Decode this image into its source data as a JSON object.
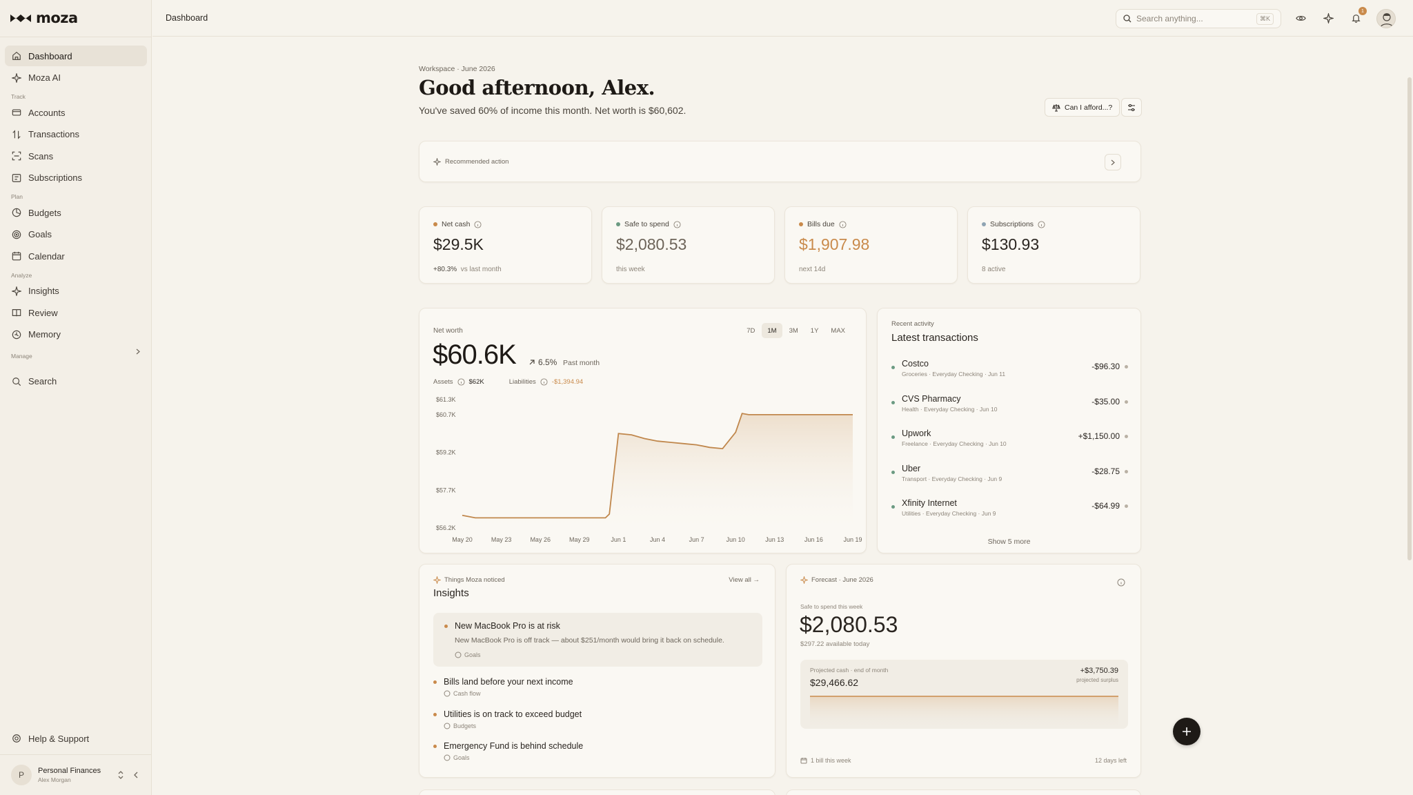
{
  "app": {
    "name": "moza"
  },
  "sidebar": {
    "nav_top": [
      {
        "label": "Dashboard",
        "icon": "home-icon",
        "active": true
      },
      {
        "label": "Moza AI",
        "icon": "sparkle-icon"
      }
    ],
    "groups": [
      {
        "label": "Track",
        "items": [
          {
            "label": "Accounts",
            "icon": "card-icon"
          },
          {
            "label": "Transactions",
            "icon": "swap-icon"
          },
          {
            "label": "Scans",
            "icon": "scan-icon"
          },
          {
            "label": "Subscriptions",
            "icon": "repeat-icon"
          }
        ]
      },
      {
        "label": "Plan",
        "items": [
          {
            "label": "Budgets",
            "icon": "pie-icon"
          },
          {
            "label": "Goals",
            "icon": "target-icon"
          },
          {
            "label": "Calendar",
            "icon": "calendar-icon"
          }
        ]
      },
      {
        "label": "Analyze",
        "items": [
          {
            "label": "Insights",
            "icon": "sparkle-icon"
          },
          {
            "label": "Review",
            "icon": "book-icon"
          },
          {
            "label": "Memory",
            "icon": "memory-icon"
          }
        ]
      }
    ],
    "manage_label": "Manage",
    "search_label": "Search",
    "help_label": "Help & Support",
    "workspace": {
      "initial": "P",
      "name": "Personal Finances",
      "user": "Alex Morgan"
    }
  },
  "topbar": {
    "breadcrumb": "Dashboard",
    "search_placeholder": "Search anything...",
    "search_shortcut": "⌘K",
    "notification_count": "1"
  },
  "header": {
    "eyebrow": "Workspace · June 2026",
    "greeting": "Good afternoon, Alex.",
    "subtitle": "You've saved 60% of income this month. Net worth is $60,602.",
    "afford_label": "Can I afford...?"
  },
  "recommended": {
    "label": "Recommended action"
  },
  "stats": [
    {
      "label": "Net cash",
      "value": "$29.5K",
      "foot_strong": "+80.3%",
      "foot": "vs last month",
      "dot": "#c98a4b",
      "value_color": "#2a2520"
    },
    {
      "label": "Safe to spend",
      "value": "$2,080.53",
      "foot_strong": "",
      "foot": "this week",
      "dot": "#6b9a82",
      "value_color": "#6d6459"
    },
    {
      "label": "Bills due",
      "value": "$1,907.98",
      "foot_strong": "",
      "foot": "next 14d",
      "dot": "#c98a4b",
      "value_color": "#c98a4b"
    },
    {
      "label": "Subscriptions",
      "value": "$130.93",
      "foot_strong": "",
      "foot": "8 active",
      "dot": "#8fa4b3",
      "value_color": "#2a2520"
    }
  ],
  "net_worth": {
    "label": "Net worth",
    "value": "$60.6K",
    "change": "6.5%",
    "period": "Past month",
    "assets_label": "Assets",
    "assets_value": "$62K",
    "liabilities_label": "Liabilities",
    "liabilities_value": "-$1,394.94",
    "ranges": [
      "7D",
      "1M",
      "3M",
      "1Y",
      "MAX"
    ],
    "active_range": "1M"
  },
  "chart_data": {
    "type": "area",
    "title": "Net worth",
    "y_tick_labels": [
      "$61.3K",
      "$60.7K",
      "$59.2K",
      "$57.7K",
      "$56.2K"
    ],
    "y_tick_values": [
      61300,
      60700,
      59200,
      57700,
      56200
    ],
    "x_tick_labels": [
      "May 20",
      "May 23",
      "May 26",
      "May 29",
      "Jun 1",
      "Jun 4",
      "Jun 7",
      "Jun 10",
      "Jun 13",
      "Jun 16",
      "Jun 19"
    ],
    "x_tick_values": [
      0,
      3,
      6,
      9,
      12,
      15,
      18,
      21,
      24,
      27,
      30
    ],
    "ylim": [
      56200,
      61300
    ],
    "xlim": [
      0,
      30
    ],
    "series": [
      {
        "x": [
          0,
          1,
          2,
          3,
          4,
          5,
          6,
          7,
          8,
          9,
          10,
          11,
          11.3,
          12,
          13,
          14,
          15,
          16,
          17,
          18,
          19,
          20,
          21,
          21.5,
          22,
          23,
          24,
          25,
          26,
          27,
          28,
          29,
          30
        ],
        "values": [
          56700,
          56600,
          56600,
          56600,
          56600,
          56600,
          56600,
          56600,
          56600,
          56600,
          56600,
          56600,
          56750,
          59950,
          59900,
          59750,
          59650,
          59600,
          59550,
          59500,
          59400,
          59350,
          60000,
          60750,
          60700,
          60700,
          60700,
          60700,
          60700,
          60700,
          60700,
          60700,
          60700
        ]
      }
    ]
  },
  "recent": {
    "label": "Recent activity",
    "title": "Latest transactions",
    "items": [
      {
        "name": "Costco",
        "meta": "Groceries · Everyday Checking · Jun 11",
        "amount": "-$96.30"
      },
      {
        "name": "CVS Pharmacy",
        "meta": "Health · Everyday Checking · Jun 10",
        "amount": "-$35.00"
      },
      {
        "name": "Upwork",
        "meta": "Freelance · Everyday Checking · Jun 10",
        "amount": "+$1,150.00"
      },
      {
        "name": "Uber",
        "meta": "Transport · Everyday Checking · Jun 9",
        "amount": "-$28.75"
      },
      {
        "name": "Xfinity Internet",
        "meta": "Utilities · Everyday Checking · Jun 9",
        "amount": "-$64.99"
      }
    ],
    "show_more": "Show 5 more"
  },
  "insights": {
    "label": "Things Moza noticed",
    "title": "Insights",
    "view_all": "View all →",
    "items": [
      {
        "name": "New MacBook Pro is at risk",
        "desc": "New MacBook Pro is off track — about $251/month would bring it back on schedule.",
        "tag": "Goals"
      },
      {
        "name": "Bills land before your next income",
        "tag": "Cash flow"
      },
      {
        "name": "Utilities is on track to exceed budget",
        "tag": "Budgets"
      },
      {
        "name": "Emergency Fund is behind schedule",
        "tag": "Goals"
      }
    ]
  },
  "forecast": {
    "label": "Forecast · June 2026",
    "small": "Safe to spend this week",
    "value": "$2,080.53",
    "available": "$297.22 available today",
    "proj_label": "Projected cash · end of month",
    "proj_value": "$29,466.62",
    "proj_delta": "+$3,750.39",
    "proj_sub": "projected surplus",
    "foot_left": "1 bill this week",
    "foot_right": "12 days left"
  }
}
